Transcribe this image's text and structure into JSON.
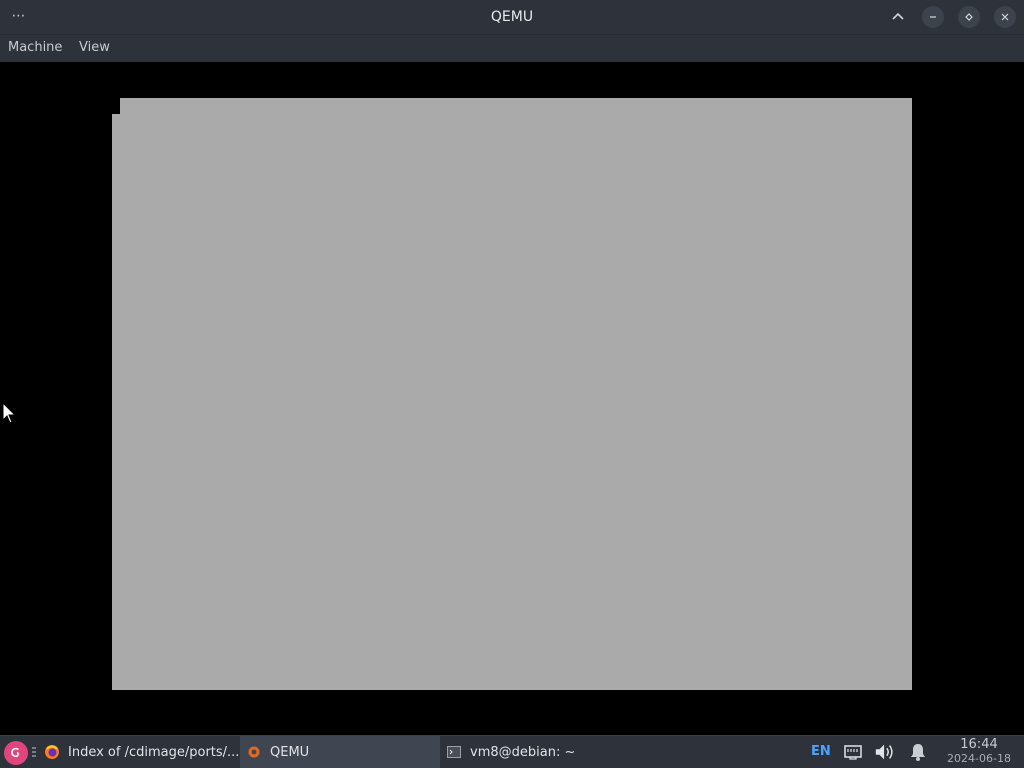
{
  "window": {
    "title": "QEMU",
    "menu_glyph": "⋯"
  },
  "menubar": {
    "items": [
      {
        "label": "Machine"
      },
      {
        "label": "View"
      }
    ]
  },
  "vm_display": {
    "background": "#aaaaaa"
  },
  "taskbar": {
    "start_icon": "debian-swirl-icon",
    "tasks": [
      {
        "label": "Index of /cdimage/ports/...",
        "icon": "firefox-icon",
        "active": false
      },
      {
        "label": "QEMU",
        "icon": "qemu-icon",
        "active": true
      },
      {
        "label": "vm8@debian: ~",
        "icon": "terminal-icon",
        "active": false
      }
    ],
    "tray": {
      "keyboard_layout": "EN",
      "network_icon": "network-wired-icon",
      "volume_icon": "speaker-icon",
      "notifications_icon": "bell-icon"
    },
    "clock": {
      "time": "16:44",
      "date": "2024-06-18"
    }
  },
  "colors": {
    "titlebar": "#2d323b",
    "accent": "#4aa3ff",
    "start_button": "#e0457b"
  }
}
